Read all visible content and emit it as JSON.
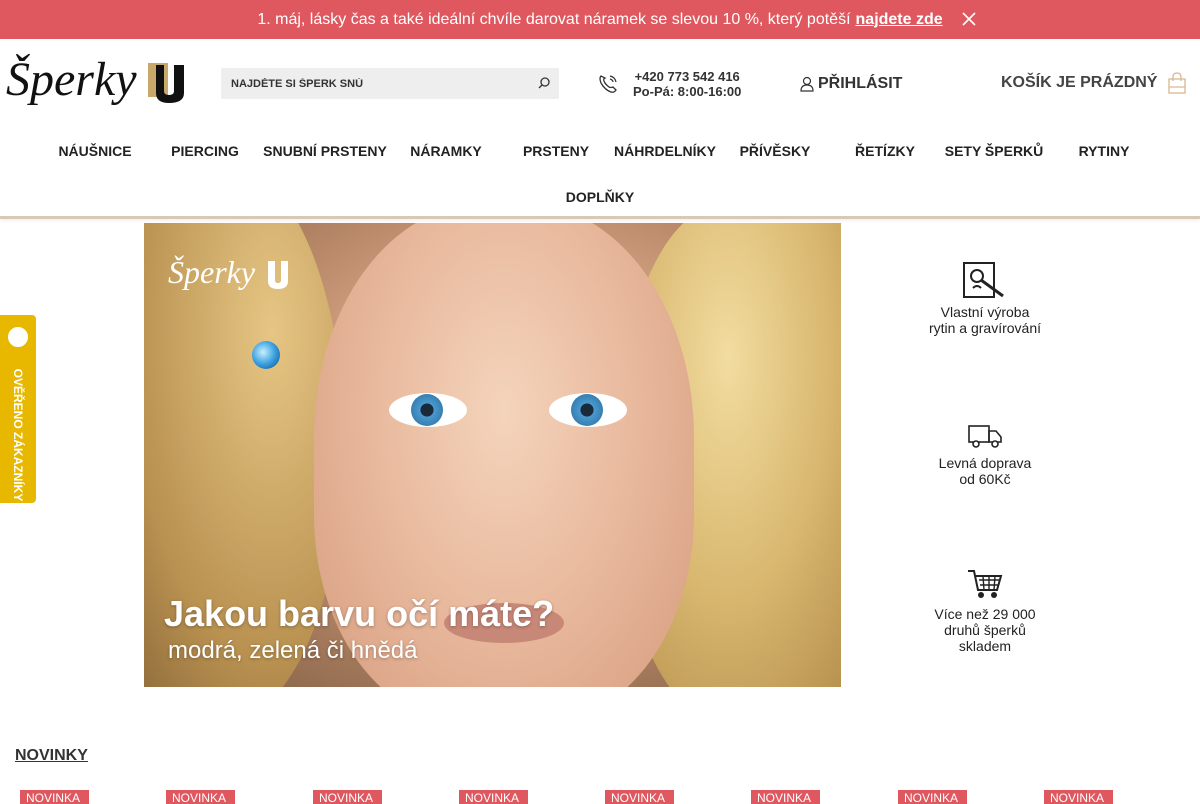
{
  "announcement": {
    "text": " 1. máj, lásky čas a také ideální chvíle darovat náramek se slevou 10 %, který potěší",
    "link": "najdete zde",
    "bg_color": "#e0585f"
  },
  "header": {
    "search_placeholder": "NAJDĚTE SI ŠPERK SNŮ",
    "phone": "+420 773 542 416",
    "hours": "Po-Pá: 8:00-16:00",
    "login": "PŘIHLÁSIT",
    "cart": "KOŠÍK JE PRÁZDNÝ"
  },
  "nav": {
    "items": [
      "NÁUŠNICE",
      "PIERCING",
      "SNUBNÍ PRSTENY",
      "NÁRAMKY",
      "PRSTENY",
      "NÁHRDELNÍKY",
      "PŘÍVĚSKY",
      "ŘETÍZKY",
      "SETY ŠPERKŮ",
      "RYTINY",
      "DOPLŇKY"
    ]
  },
  "banner": {
    "headline": "Jakou barvu očí máte?",
    "subline": "modrá, zelená či hnědá"
  },
  "features": [
    {
      "icon": "engraving-icon",
      "line1": "Vlastní výroba",
      "line2": "rytin a gravírování",
      "line3": ""
    },
    {
      "icon": "truck-icon",
      "line1": "Levná doprava",
      "line2": "od 60Kč",
      "line3": ""
    },
    {
      "icon": "cart-icon",
      "line1": "Více než 29 000",
      "line2": "druhů šperků",
      "line3": "skladem"
    }
  ],
  "side_badge": "OVĚŘENO ZÁKAZNÍKY",
  "section": {
    "title": "NOVINKY",
    "tag": "NOVINKA"
  }
}
